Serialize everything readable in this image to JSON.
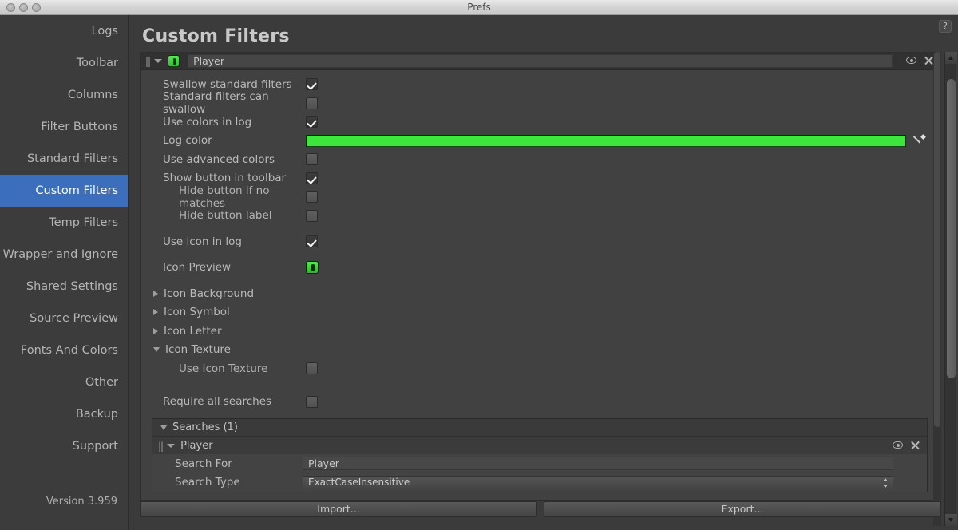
{
  "window": {
    "title": "Prefs",
    "traffic_lights": [
      "close",
      "minimize",
      "zoom"
    ]
  },
  "sidebar": {
    "items": [
      {
        "label": "Logs",
        "selected": false
      },
      {
        "label": "Toolbar",
        "selected": false
      },
      {
        "label": "Columns",
        "selected": false
      },
      {
        "label": "Filter Buttons",
        "selected": false
      },
      {
        "label": "Standard Filters",
        "selected": false
      },
      {
        "label": "Custom Filters",
        "selected": true
      },
      {
        "label": "Temp Filters",
        "selected": false
      },
      {
        "label": "Wrapper and Ignore",
        "selected": false
      },
      {
        "label": "Shared Settings",
        "selected": false
      },
      {
        "label": "Source Preview",
        "selected": false
      },
      {
        "label": "Fonts And Colors",
        "selected": false
      },
      {
        "label": "Other",
        "selected": false
      },
      {
        "label": "Backup",
        "selected": false
      },
      {
        "label": "Support",
        "selected": false
      }
    ],
    "version": "Version 3.959",
    "selected_color": "#3b6ebc"
  },
  "main": {
    "page_title": "Custom Filters",
    "help_label": "?"
  },
  "filter": {
    "header": {
      "grip": "||",
      "name_value": "Player",
      "eye_icon": "visibility-icon",
      "close_icon": "close-icon"
    },
    "rows": [
      {
        "label": "Swallow standard filters",
        "checked": true
      },
      {
        "label": "Standard filters can swallow",
        "checked": false
      },
      {
        "label": "Use colors in log",
        "checked": true
      }
    ],
    "log_color": {
      "label": "Log color",
      "value": "#3ce63c",
      "picker_icon": "eyedropper-icon"
    },
    "rows2": [
      {
        "label": "Use advanced colors",
        "checked": false
      },
      {
        "label": "Show button in toolbar",
        "checked": true
      },
      {
        "label": "Hide button if no matches",
        "checked": false,
        "indent": true
      },
      {
        "label": "Hide button label",
        "checked": false,
        "indent": true
      }
    ],
    "use_icon_in_log": {
      "label": "Use icon in log",
      "checked": true
    },
    "icon_preview": {
      "label": "Icon Preview",
      "color": "#3ce63c"
    },
    "foldouts": [
      {
        "label": "Icon Background",
        "open": false
      },
      {
        "label": "Icon Symbol",
        "open": false
      },
      {
        "label": "Icon Letter",
        "open": false
      },
      {
        "label": "Icon Texture",
        "open": true
      }
    ],
    "use_icon_texture": {
      "label": "Use Icon Texture",
      "checked": false
    },
    "require_all_searches": {
      "label": "Require all searches",
      "checked": false
    }
  },
  "searches": {
    "header_label": "Searches (1)",
    "item": {
      "grip": "||",
      "name": "Player",
      "eye_icon": "visibility-icon",
      "close_icon": "close-icon",
      "fields": [
        {
          "label": "Search For",
          "value": "Player",
          "type": "text"
        },
        {
          "label": "Search Type",
          "value": "ExactCaseInsensitive",
          "type": "popup"
        }
      ]
    }
  },
  "footer": {
    "import_label": "Import...",
    "export_label": "Export..."
  }
}
